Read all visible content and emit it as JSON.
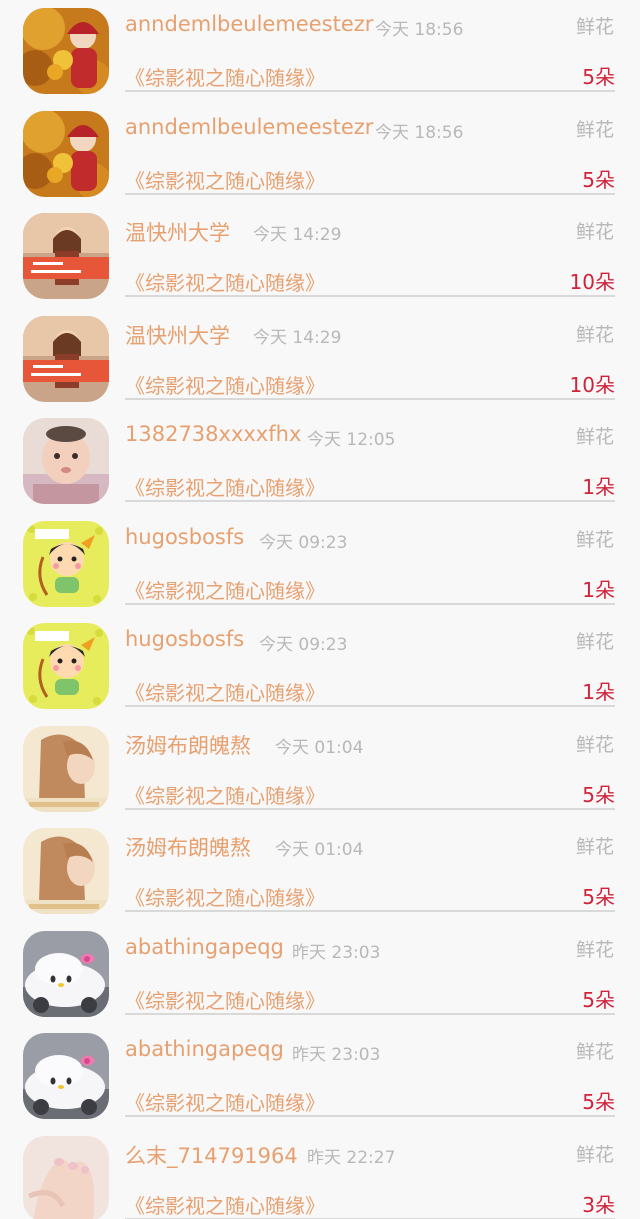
{
  "gift_list": [
    {
      "avatar": "autumn-girl-avatar",
      "name": "anndemlbeulemeestezr",
      "time": "今天 18:56",
      "gift": "鲜花",
      "book": "《综影视之随心随缘》",
      "count": "5朵"
    },
    {
      "avatar": "autumn-girl-avatar",
      "name": "anndemlbeulemeestezr",
      "time": "今天 18:56",
      "gift": "鲜花",
      "book": "《综影视之随心随缘》",
      "count": "5朵"
    },
    {
      "avatar": "poster-girl-avatar",
      "name": "温快州大学",
      "time": "今天 14:29",
      "gift": "鲜花",
      "book": "《综影视之随心随缘》",
      "count": "10朵"
    },
    {
      "avatar": "poster-girl-avatar",
      "name": "温快州大学",
      "time": "今天 14:29",
      "gift": "鲜花",
      "book": "《综影视之随心随缘》",
      "count": "10朵"
    },
    {
      "avatar": "baby-avatar",
      "name": "1382738xxxxfhx",
      "time": "今天 12:05",
      "gift": "鲜花",
      "book": "《综影视之随心随缘》",
      "count": "1朵"
    },
    {
      "avatar": "cupid-cartoon-avatar",
      "name": "hugosbosfs",
      "time": "今天 09:23",
      "gift": "鲜花",
      "book": "《综影视之随心随缘》",
      "count": "1朵"
    },
    {
      "avatar": "cupid-cartoon-avatar",
      "name": "hugosbosfs",
      "time": "今天 09:23",
      "gift": "鲜花",
      "book": "《综影视之随心随缘》",
      "count": "1朵"
    },
    {
      "avatar": "profile-girl-avatar",
      "name": "汤姆布朗魄熬",
      "time": "今天 01:04",
      "gift": "鲜花",
      "book": "《综影视之随心随缘》",
      "count": "5朵"
    },
    {
      "avatar": "profile-girl-avatar",
      "name": "汤姆布朗魄熬",
      "time": "今天 01:04",
      "gift": "鲜花",
      "book": "《综影视之随心随缘》",
      "count": "5朵"
    },
    {
      "avatar": "hello-kitty-car-avatar",
      "name": "abathingapeqg",
      "time": "昨天 23:03",
      "gift": "鲜花",
      "book": "《综影视之随心随缘》",
      "count": "5朵"
    },
    {
      "avatar": "hello-kitty-car-avatar",
      "name": "abathingapeqg",
      "time": "昨天 23:03",
      "gift": "鲜花",
      "book": "《综影视之随心随缘》",
      "count": "5朵"
    },
    {
      "avatar": "hands-avatar",
      "name": "么末_714791964",
      "time": "昨天 22:27",
      "gift": "鲜花",
      "book": "《综影视之随心随缘》",
      "count": "3朵"
    }
  ],
  "colors": {
    "name": "#e7a06f",
    "meta": "#b8b8b8",
    "count": "#d0233a",
    "divider": "#d9d9d9",
    "background": "#f8f8f8"
  }
}
